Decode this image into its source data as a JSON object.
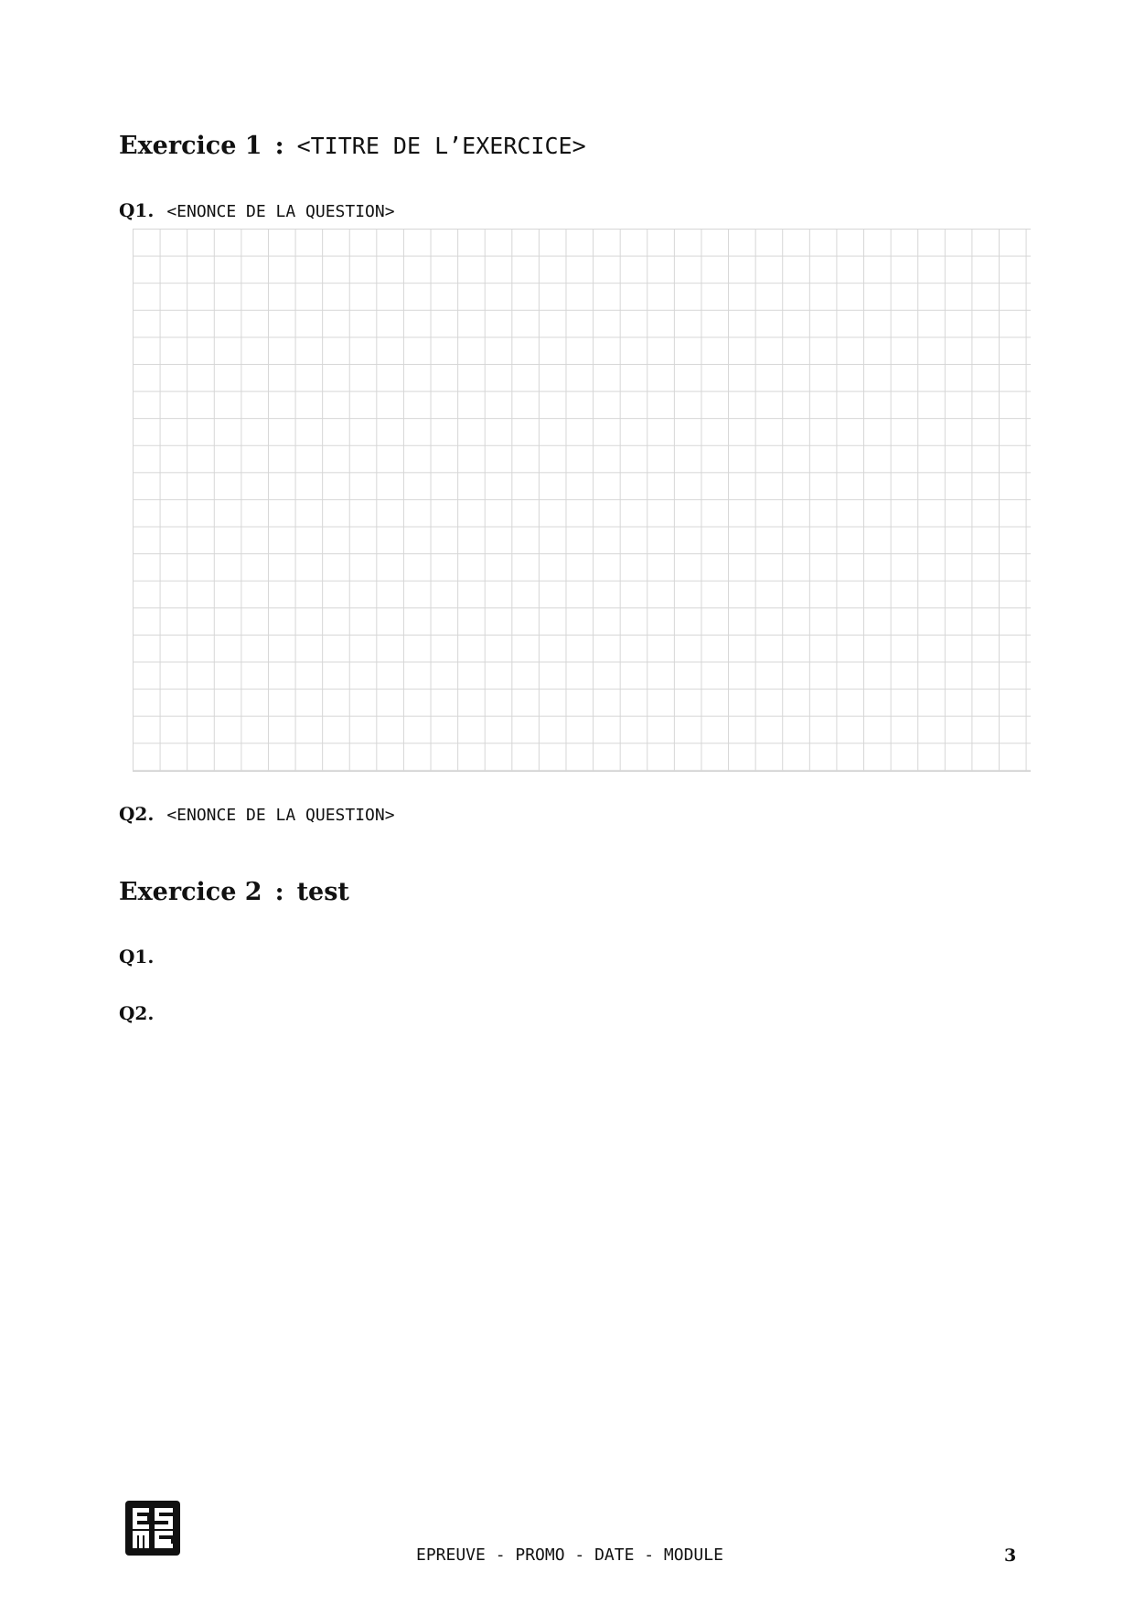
{
  "exercise1": {
    "label": "Exercice 1",
    "separator": ":",
    "title": "<TITRE DE L’EXERCICE>",
    "q1": {
      "label": "Q1.",
      "text": "<ENONCE DE LA QUESTION>"
    },
    "q2": {
      "label": "Q2.",
      "text": "<ENONCE DE LA QUESTION>"
    }
  },
  "exercise2": {
    "label": "Exercice 2",
    "separator": ":",
    "title": "test",
    "q1": {
      "label": "Q1."
    },
    "q2": {
      "label": "Q2."
    }
  },
  "footer": {
    "logo": "ES ME",
    "text": "EPREUVE - PROMO - DATE - MODULE",
    "page_number": "3"
  },
  "colors": {
    "grid_line": "#d6d6d6",
    "text": "#111111"
  }
}
